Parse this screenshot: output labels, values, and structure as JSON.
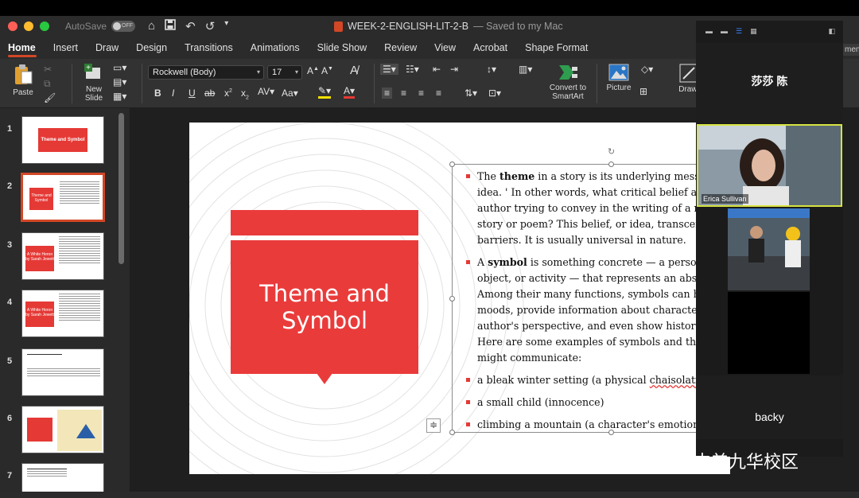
{
  "titlebar": {
    "autosave_label": "AutoSave",
    "autosave_state": "OFF",
    "doc_name": "WEEK-2-ENGLISH-LIT-2-B",
    "saved_status": "— Saved to my Mac"
  },
  "tabs": [
    "Home",
    "Insert",
    "Draw",
    "Design",
    "Transitions",
    "Animations",
    "Slide Show",
    "Review",
    "View",
    "Acrobat",
    "Shape Format"
  ],
  "ribbon": {
    "paste": "Paste",
    "new_slide_1": "New",
    "new_slide_2": "Slide",
    "font_name": "Rockwell (Body)",
    "font_size": "17",
    "aa_label": "Aa",
    "convert_1": "Convert to",
    "convert_2": "SmartArt",
    "picture": "Picture",
    "drawing": "Drawi"
  },
  "thumbnails": {
    "nums": [
      "1",
      "2",
      "3",
      "4",
      "5",
      "6",
      "7"
    ],
    "t1_title": "Theme and Symbol",
    "t2_title": "Theme and Symbol",
    "t3_title": "A White Heron by Sarah Jewett",
    "t4_title": "A White Heron by Sarah Jewett"
  },
  "slide": {
    "title": "Theme and\nSymbol",
    "p1_a": "The ",
    "p1_b": "theme",
    "p1_c": " in a story is its underlying messag",
    "p1_l2": "idea. ' In other words, what critical belief abou",
    "p1_l3": "author trying to convey in the writing of a nov",
    "p1_l4": "story or poem? This belief, or idea, transcend",
    "p1_l5": "barriers. It is usually universal in nature.",
    "p2_a": " A ",
    "p2_b": "symbol",
    "p2_c": " is something concrete — a person",
    "p2_l2": "object, or activity — that represents an abstra",
    "p2_l3": "Among their many functions, symbols can hel",
    "p2_l4": "moods, provide information about characters",
    "p2_l5": "author's perspective, and even show historica",
    "p2_l6": "Here are some examples of symbols and the i",
    "p2_l7": "might communicate:",
    "p3_a": "a bleak winter setting (a physical ",
    "p3_b": "chaisolation",
    "p4": "a small child (innocence)",
    "p5": "climbing a mountain (a character's emotional"
  },
  "zoom": {
    "tile1_name": "莎莎 陈",
    "erica_label": "Erica Sullivan",
    "tile_backy": "backy",
    "ments": "ments"
  },
  "watermark": "力迈中美九华校区"
}
